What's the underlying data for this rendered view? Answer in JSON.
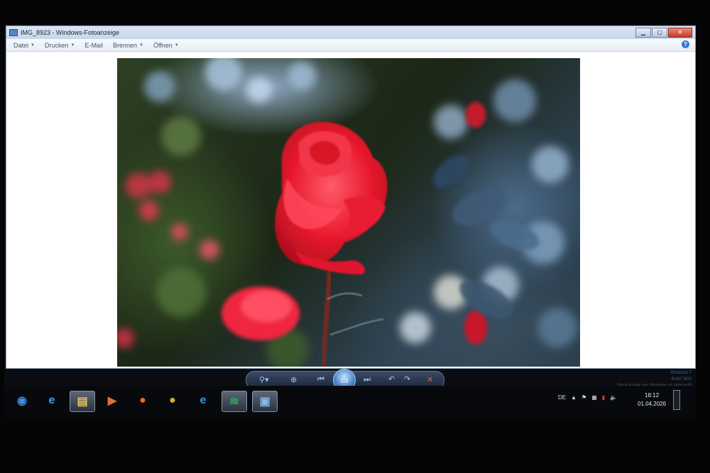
{
  "window": {
    "title": "IMG_8923 - Windows-Fotoanzeige",
    "controls": {
      "minimize": "▁",
      "maximize": "▢",
      "close": "✕"
    }
  },
  "menubar": {
    "items": [
      {
        "label": "Datei",
        "caret": "▼"
      },
      {
        "label": "Drucken",
        "caret": "▼"
      },
      {
        "label": "E-Mail",
        "caret": ""
      },
      {
        "label": "Brennen",
        "caret": "▼"
      },
      {
        "label": "Öffnen",
        "caret": "▼"
      }
    ],
    "help": "?"
  },
  "viewer_controls": {
    "zoom": "⚲▾",
    "fit": "⊕",
    "previous": "⏮",
    "slideshow": "▭",
    "next": "⏭",
    "rotate_left": "↶",
    "rotate_right": "↷",
    "delete": "✕"
  },
  "watermark": {
    "line1": "Windows 7",
    "line2": "Build 7601",
    "line3": "Diese Kopie von Windows ist nicht echt"
  },
  "taskbar": {
    "icons": [
      {
        "name": "start-orb-icon",
        "glyph": "◉",
        "color": "#3a8ee6",
        "active": false
      },
      {
        "name": "internet-explorer-icon",
        "glyph": "e",
        "color": "#3fa3ea",
        "active": false
      },
      {
        "name": "file-explorer-icon",
        "glyph": "▤",
        "color": "#e8c35a",
        "active": true
      },
      {
        "name": "media-player-icon",
        "glyph": "▶",
        "color": "#e86a3a",
        "active": false
      },
      {
        "name": "firefox-icon",
        "glyph": "●",
        "color": "#f26a1b",
        "active": false
      },
      {
        "name": "chrome-icon",
        "glyph": "●",
        "color": "#e0b12c",
        "active": false
      },
      {
        "name": "edge-icon",
        "glyph": "e",
        "color": "#2a9bd8",
        "active": false
      },
      {
        "name": "spotify-icon",
        "glyph": "≋",
        "color": "#1db954",
        "active": true
      },
      {
        "name": "photo-viewer-icon",
        "glyph": "▣",
        "color": "#8ab8e8",
        "active": true
      }
    ]
  },
  "tray": {
    "language": "DE",
    "show_hidden": "▲",
    "flag": "⚑",
    "action_center": "▦",
    "network": "▮",
    "volume": "🔈"
  },
  "clock": {
    "time": "18:12",
    "date": "01.04.2026"
  }
}
